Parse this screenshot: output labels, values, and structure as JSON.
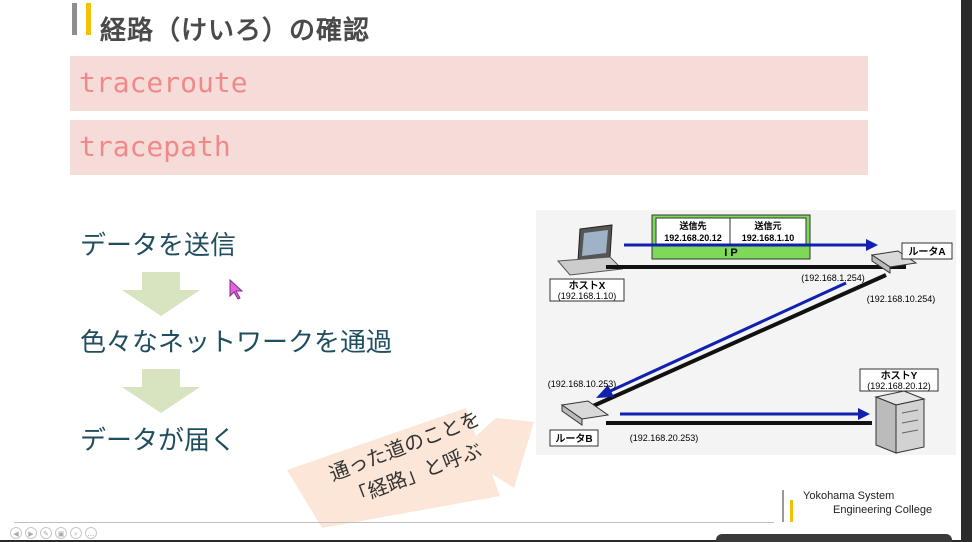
{
  "slide": {
    "title": "経路（けいろ）の確認",
    "commands": [
      "traceroute",
      "tracepath"
    ],
    "steps": [
      "データを送信",
      "色々なネットワークを通過",
      "データが届く"
    ],
    "callout": {
      "line1": "通った道のことを",
      "line2": "「経路」と呼ぶ"
    },
    "college": {
      "line1": "Yokohama System",
      "line2": "Engineering College"
    }
  },
  "diagram": {
    "ip_header": {
      "src_dst_label": "送信先",
      "dst_addr": "192.168.20.12",
      "src_label": "送信元",
      "src_addr": "192.168.1.10",
      "protocol": "I P"
    },
    "host_x": {
      "name": "ホストX",
      "addr": "(192.168.1.10)"
    },
    "host_y": {
      "name": "ホストY",
      "addr": "(192.168.20.12)"
    },
    "router_a": {
      "name": "ルータA",
      "addr_in": "(192.168.1.254)",
      "addr_out": "(192.168.10.254)"
    },
    "router_b": {
      "name": "ルータB",
      "addr_in": "(192.168.10.253)",
      "addr_out": "(192.168.20.253)"
    }
  },
  "colors": {
    "arrow_blue": "#1020b0",
    "cmd_bg": "#f6dcd8",
    "cmd_text": "#f08a8a",
    "step_text": "#1f4e5f",
    "accent": "#f2c200",
    "ip_green": "#7ed957"
  }
}
